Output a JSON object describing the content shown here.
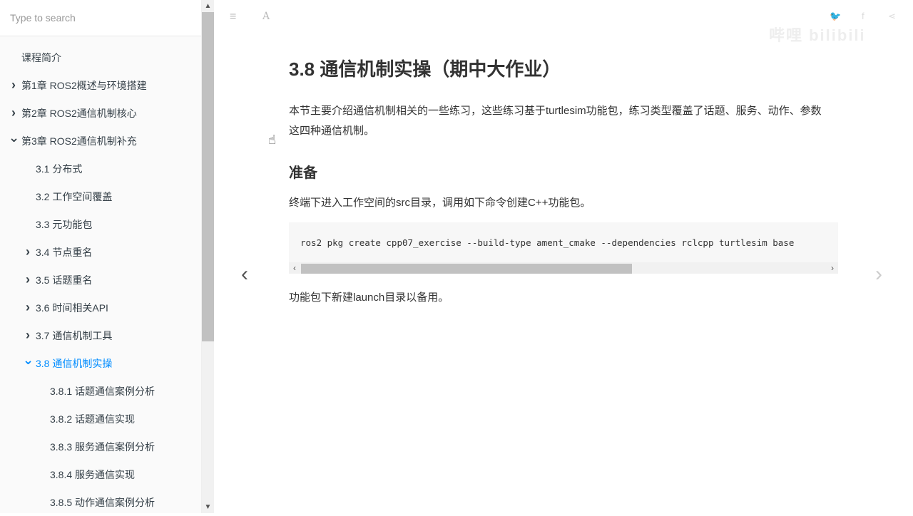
{
  "sidebar": {
    "search_placeholder": "Type to search",
    "items": [
      {
        "label": "课程简介",
        "level": 0,
        "chevron": ""
      },
      {
        "label": "第1章 ROS2概述与环境搭建",
        "level": 0,
        "chevron": "right"
      },
      {
        "label": "第2章 ROS2通信机制核心",
        "level": 0,
        "chevron": "right"
      },
      {
        "label": "第3章 ROS2通信机制补充",
        "level": 0,
        "chevron": "down"
      },
      {
        "label": "3.1 分布式",
        "level": 1,
        "chevron": ""
      },
      {
        "label": "3.2 工作空间覆盖",
        "level": 1,
        "chevron": ""
      },
      {
        "label": "3.3 元功能包",
        "level": 1,
        "chevron": ""
      },
      {
        "label": "3.4 节点重名",
        "level": 1,
        "chevron": "right"
      },
      {
        "label": "3.5 话题重名",
        "level": 1,
        "chevron": "right"
      },
      {
        "label": "3.6 时间相关API",
        "level": 1,
        "chevron": "right"
      },
      {
        "label": "3.7 通信机制工具",
        "level": 1,
        "chevron": "right"
      },
      {
        "label": "3.8 通信机制实操",
        "level": 1,
        "chevron": "down",
        "active": true
      },
      {
        "label": "3.8.1 话题通信案例分析",
        "level": 2,
        "chevron": ""
      },
      {
        "label": "3.8.2 话题通信实现",
        "level": 2,
        "chevron": ""
      },
      {
        "label": "3.8.3 服务通信案例分析",
        "level": 2,
        "chevron": ""
      },
      {
        "label": "3.8.4 服务通信实现",
        "level": 2,
        "chevron": ""
      },
      {
        "label": "3.8.5 动作通信案例分析",
        "level": 2,
        "chevron": ""
      }
    ]
  },
  "content": {
    "title": "3.8 通信机制实操（期中大作业）",
    "intro": "本节主要介绍通信机制相关的一些练习，这些练习基于turtlesim功能包，练习类型覆盖了话题、服务、动作、参数这四种通信机制。",
    "section_heading": "准备",
    "prep_text": "终端下进入工作空间的src目录，调用如下命令创建C++功能包。",
    "code": "ros2 pkg create cpp07_exercise --build-type ament_cmake --dependencies rclcpp turtlesim base",
    "after_code": "功能包下新建launch目录以备用。"
  },
  "accent": "#008cff"
}
